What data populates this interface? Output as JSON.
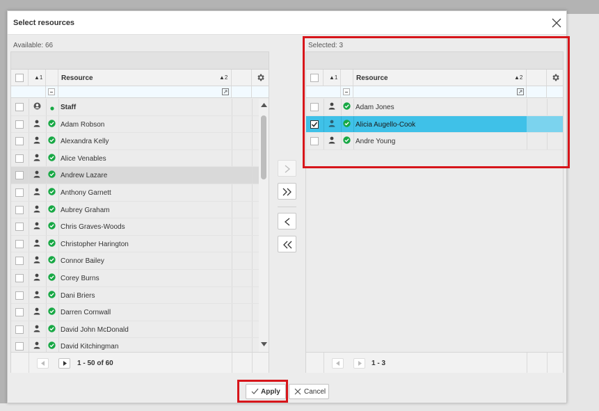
{
  "dialog": {
    "title": "Select resources",
    "apply_label": "Apply",
    "cancel_label": "Cancel"
  },
  "available": {
    "caption": "Available: 66",
    "columns": {
      "sort1": "▲1",
      "resource": "Resource",
      "sort2": "▲2"
    },
    "rows": [
      {
        "name": "Staff",
        "type": "group"
      },
      {
        "name": "Adam Robson"
      },
      {
        "name": "Alexandra Kelly"
      },
      {
        "name": "Alice Venables"
      },
      {
        "name": "Andrew Lazare",
        "hover": true
      },
      {
        "name": "Anthony Garnett"
      },
      {
        "name": "Aubrey Graham"
      },
      {
        "name": "Chris Graves-Woods"
      },
      {
        "name": "Christopher Harington"
      },
      {
        "name": "Connor Bailey"
      },
      {
        "name": "Corey Burns"
      },
      {
        "name": "Dani Briers"
      },
      {
        "name": "Darren Cornwall"
      },
      {
        "name": "David John McDonald"
      },
      {
        "name": "David Kitchingman"
      }
    ],
    "pager": "1 - 50 of 60"
  },
  "selected": {
    "caption": "Selected: 3",
    "columns": {
      "sort1": "▲1",
      "resource": "Resource",
      "sort2": "▲2"
    },
    "rows": [
      {
        "name": "Adam Jones"
      },
      {
        "name": "Alicia Augello-Cook",
        "selected": true
      },
      {
        "name": "Andre Young"
      }
    ],
    "pager": "1 - 3"
  },
  "colors": {
    "selected_row": "#3fc1e8",
    "status_green": "#17a844",
    "highlight_red": "#d7151a"
  },
  "icons": {
    "person": "person-icon",
    "status": "check-circle-icon",
    "settings": "gear-icon",
    "close": "close-icon"
  }
}
